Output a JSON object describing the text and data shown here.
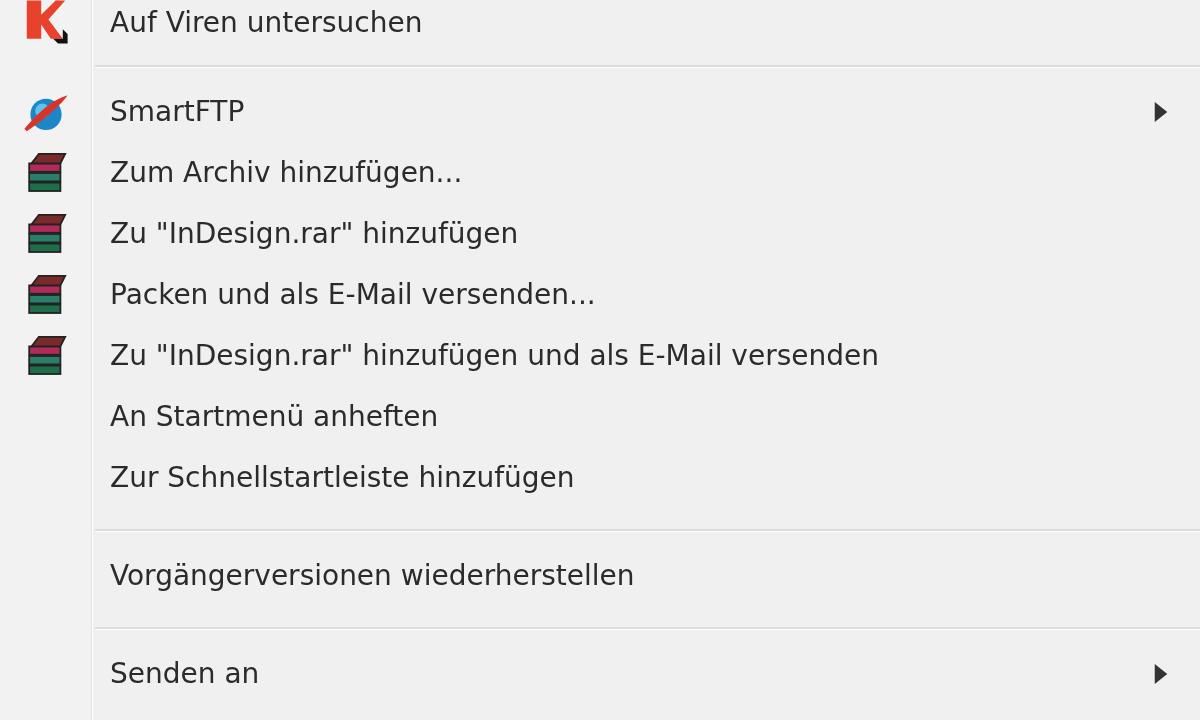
{
  "context_menu": {
    "items": [
      {
        "kind": "scan",
        "label": "Auf Viren untersuchen",
        "submenu": false
      },
      {
        "kind": "separator"
      },
      {
        "kind": "ftp",
        "label": "SmartFTP",
        "submenu": true
      },
      {
        "kind": "archive",
        "label": "Zum Archiv hinzufügen...",
        "submenu": false
      },
      {
        "kind": "archive",
        "label": "Zu \"InDesign.rar\" hinzufügen",
        "submenu": false
      },
      {
        "kind": "archive",
        "label": "Packen und als E-Mail versenden...",
        "submenu": false
      },
      {
        "kind": "archive",
        "label": "Zu \"InDesign.rar\" hinzufügen und als E-Mail versenden",
        "submenu": false
      },
      {
        "kind": "plain",
        "label": "An Startmenü anheften",
        "submenu": false
      },
      {
        "kind": "plain",
        "label": "Zur Schnellstartleiste hinzufügen",
        "submenu": false
      },
      {
        "kind": "separator"
      },
      {
        "kind": "plain",
        "label": "Vorgängerversionen wiederherstellen",
        "submenu": false
      },
      {
        "kind": "separator"
      },
      {
        "kind": "plain",
        "label": "Senden an",
        "submenu": true
      }
    ]
  }
}
